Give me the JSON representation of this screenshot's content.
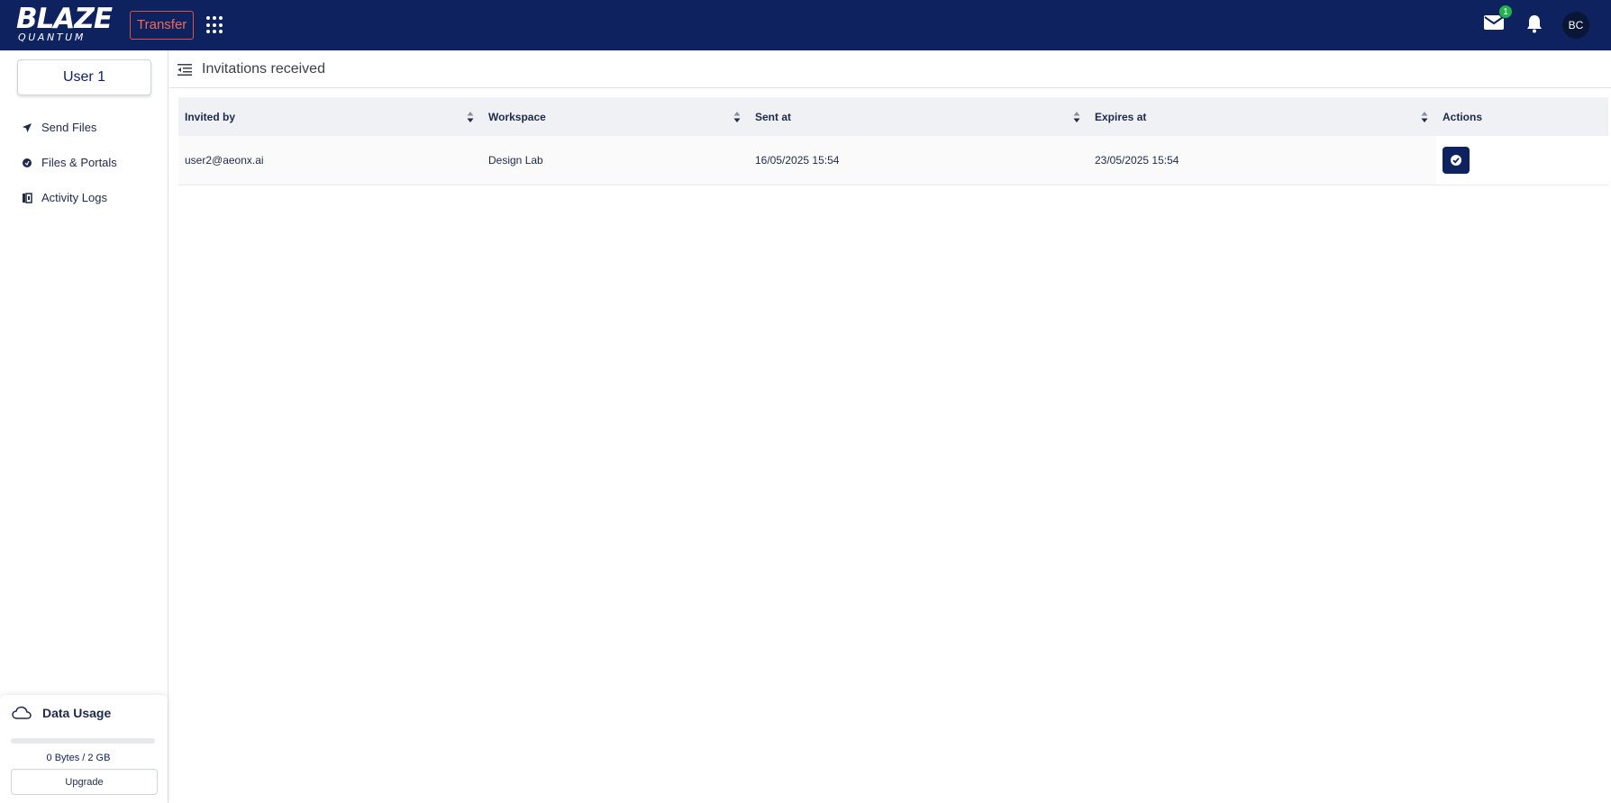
{
  "header": {
    "logo_main": "BLAZE",
    "logo_sub": "QUANTUM",
    "product_label": "Transfer",
    "mail_badge_count": "1",
    "avatar_initials": "BC"
  },
  "sidebar": {
    "user_label": "User 1",
    "items": [
      {
        "label": "Send Files",
        "icon": "send-icon"
      },
      {
        "label": "Files & Portals",
        "icon": "files-portals-icon"
      },
      {
        "label": "Activity Logs",
        "icon": "activity-logs-icon"
      }
    ],
    "data_usage": {
      "title": "Data Usage",
      "used_fraction": 0,
      "usage_text": "0 Bytes / 2 GB",
      "upgrade_label": "Upgrade"
    }
  },
  "main": {
    "page_title": "Invitations received",
    "table": {
      "columns": [
        "Invited by",
        "Workspace",
        "Sent at",
        "Expires at",
        "Actions"
      ],
      "rows": [
        {
          "invited_by": "user2@aeonx.ai",
          "workspace": "Design Lab",
          "sent_at": "16/05/2025 15:54",
          "expires_at": "23/05/2025 15:54"
        }
      ]
    }
  },
  "colors": {
    "brand_navy": "#0f2260",
    "transfer_accent": "#e0523f",
    "badge_green": "#22b24c"
  }
}
